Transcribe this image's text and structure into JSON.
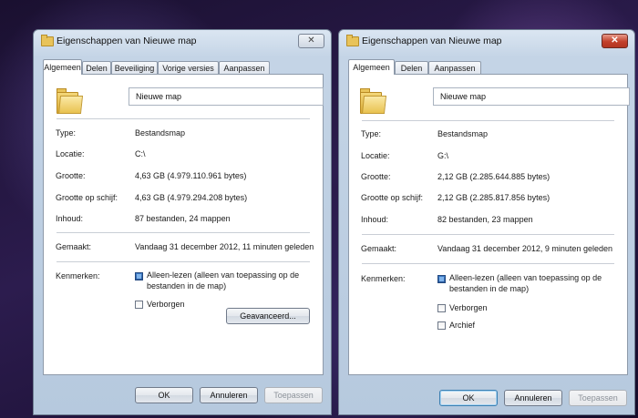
{
  "windows": [
    {
      "title": "Eigenschappen van Nieuwe map",
      "close_glyph": "✕",
      "tabs": [
        "Algemeen",
        "Delen",
        "Beveiliging",
        "Vorige versies",
        "Aanpassen"
      ],
      "active_tab": "Algemeen",
      "folder_name": "Nieuwe map",
      "labels": {
        "type": "Type:",
        "location": "Locatie:",
        "size": "Grootte:",
        "size_on_disk": "Grootte op schijf:",
        "contents": "Inhoud:",
        "created": "Gemaakt:",
        "attributes": "Kenmerken:"
      },
      "values": {
        "type": "Bestandsmap",
        "location": "C:\\",
        "size": "4,63 GB (4.979.110.961 bytes)",
        "size_on_disk": "4,63 GB (4.979.294.208 bytes)",
        "contents": "87 bestanden, 24 mappen",
        "created": "Vandaag 31 december 2012, 11 minuten geleden"
      },
      "attributes": {
        "readonly_line1": "Alleen-lezen (alleen van toepassing op de",
        "readonly_line2": "bestanden in de map)",
        "readonly_checked": true,
        "hidden": "Verborgen",
        "hidden_checked": false
      },
      "advanced_button": "Geavanceerd...",
      "buttons": {
        "ok": "OK",
        "cancel": "Annuleren",
        "apply": "Toepassen"
      }
    },
    {
      "title": "Eigenschappen van Nieuwe map",
      "close_glyph": "✕",
      "tabs": [
        "Algemeen",
        "Delen",
        "Aanpassen"
      ],
      "active_tab": "Algemeen",
      "folder_name": "Nieuwe map",
      "labels": {
        "type": "Type:",
        "location": "Locatie:",
        "size": "Grootte:",
        "size_on_disk": "Grootte op schijf:",
        "contents": "Inhoud:",
        "created": "Gemaakt:",
        "attributes": "Kenmerken:"
      },
      "values": {
        "type": "Bestandsmap",
        "location": "G:\\",
        "size": "2,12 GB (2.285.644.885 bytes)",
        "size_on_disk": "2,12 GB (2.285.817.856 bytes)",
        "contents": "82 bestanden, 23 mappen",
        "created": "Vandaag 31 december 2012, 9 minuten geleden"
      },
      "attributes": {
        "readonly_line1": "Alleen-lezen (alleen van toepassing op de",
        "readonly_line2": "bestanden in de map)",
        "readonly_checked": true,
        "hidden": "Verborgen",
        "hidden_checked": false,
        "archive": "Archief",
        "archive_checked": false
      },
      "buttons": {
        "ok": "OK",
        "cancel": "Annuleren",
        "apply": "Toepassen"
      }
    }
  ]
}
